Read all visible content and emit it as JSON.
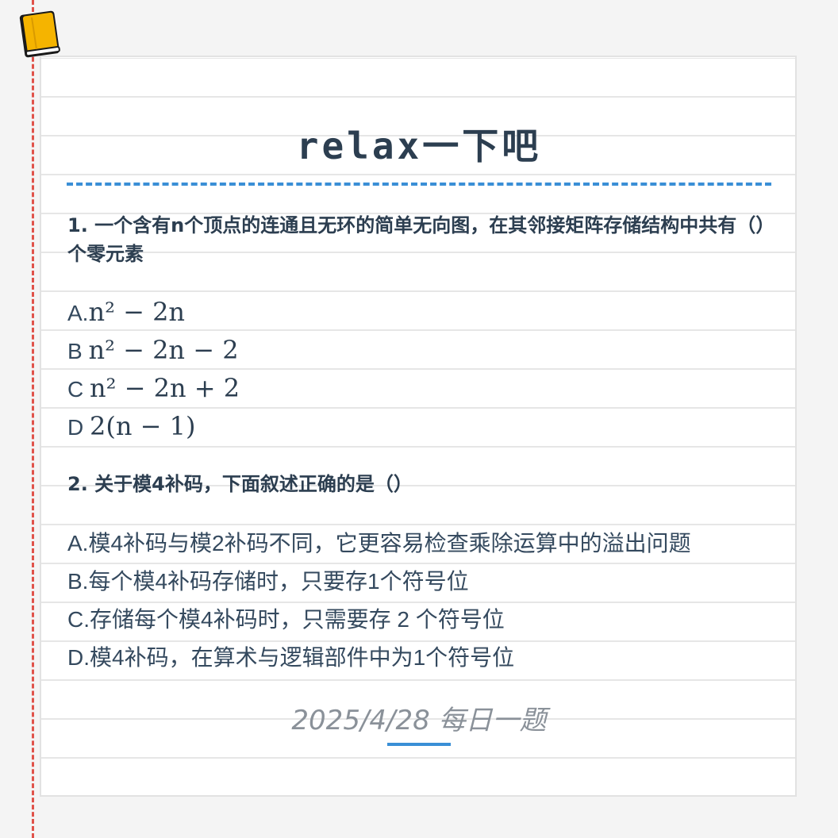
{
  "title": "relax一下吧",
  "questions": [
    {
      "text": "1. 一个含有n个顶点的连通且无环的简单无向图，在其邻接矩阵存储结构中共有（）个零元素",
      "options": [
        {
          "letter": "A.",
          "math": "n² − 2n"
        },
        {
          "letter": "B ",
          "math": "n² − 2n − 2"
        },
        {
          "letter": "C ",
          "math": "n² − 2n + 2"
        },
        {
          "letter": "D ",
          "math": "2(n − 1)"
        }
      ]
    },
    {
      "text": "2. 关于模4补码，下面叙述正确的是（）",
      "options": [
        {
          "text": "A.模4补码与模2补码不同，它更容易检查乘除运算中的溢出问题"
        },
        {
          "text": "B.每个模4补码存储时，只要存1个符号位"
        },
        {
          "text": "C.存储每个模4补码时，只需要存 2 个符号位"
        },
        {
          "text": "D.模4补码，在算术与逻辑部件中为1个符号位"
        }
      ]
    }
  ],
  "footer": {
    "date": "2025/4/28 每日一题"
  },
  "colors": {
    "accent": "#3a8fd6",
    "margin_line": "#e0524a",
    "title": "#2c3e50",
    "body_text": "#34495e",
    "footer_text": "#8a9199",
    "notebook": "#f5b400"
  },
  "icons": {
    "notebook": "notebook-icon"
  }
}
